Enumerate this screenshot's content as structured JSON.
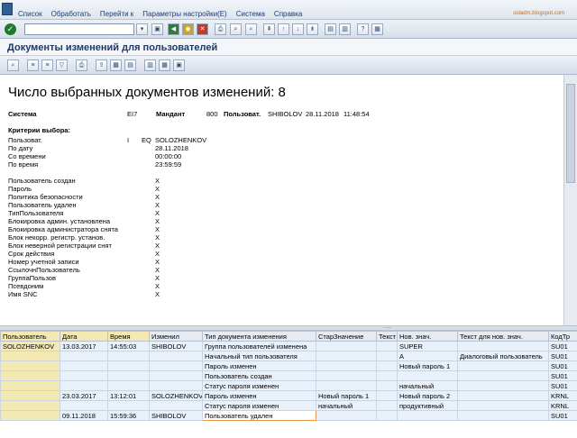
{
  "menu": [
    "Список",
    "Обработать",
    "Перейти к",
    "Параметры настройки(E)",
    "Система",
    "Справка"
  ],
  "site": "sidadm.blogspot.com",
  "title": "Документы изменений для пользователей",
  "report": {
    "heading": "Число выбранных документов изменений: 8",
    "system_label": "Система",
    "system_value": "EI7",
    "client_label": "Мандант",
    "client_value": "800",
    "user_label": "Пользоват.",
    "user_value": "SHIBOLOV",
    "date_value": "28.11.2018",
    "time_value": "11:48:54",
    "criteria_title": "Критерии выбора:",
    "criteria": [
      {
        "label": "Пользоват.",
        "sign": "I",
        "option": "EQ",
        "value": "SOLOZHENKOV"
      },
      {
        "label": "По дату",
        "sign": "",
        "option": "",
        "value": "28.11.2018"
      },
      {
        "label": "Со времени",
        "sign": "",
        "option": "",
        "value": "00:00:00"
      },
      {
        "label": "По время",
        "sign": "",
        "option": "",
        "value": "23:59:59"
      }
    ],
    "flags": [
      {
        "label": "Пользователь создан",
        "value": "X"
      },
      {
        "label": "Пароль",
        "value": "X"
      },
      {
        "label": "Политика безопасности",
        "value": "X"
      },
      {
        "label": "Пользователь удален",
        "value": "X"
      },
      {
        "label": "ТипПользователя",
        "value": "X"
      },
      {
        "label": "Блокировка админ. установлена",
        "value": "X"
      },
      {
        "label": "Блокировка администратора снята",
        "value": "X"
      },
      {
        "label": "Блок некорр. регистр. установ.",
        "value": "X"
      },
      {
        "label": "Блок неверной регистрации снят",
        "value": "X"
      },
      {
        "label": "Срок действия",
        "value": "X"
      },
      {
        "label": "Номер учетной записи",
        "value": "X"
      },
      {
        "label": "СсылочнПользователь",
        "value": "X"
      },
      {
        "label": "ГруппаПользов",
        "value": "X"
      },
      {
        "label": "Псевдоним",
        "value": "X"
      },
      {
        "label": "Имя SNC",
        "value": "X"
      }
    ]
  },
  "table": {
    "columns": [
      "Пользователь",
      "Дата",
      "Время",
      "Изменил",
      "Тип документа изменения",
      "СтарЗначение",
      "Текст",
      "Нов. знач.",
      "Текст для нов. знач.",
      "КодТр"
    ],
    "rows": [
      [
        "SOLOZHENKOV",
        "13.03.2017",
        "14:55:03",
        "SHIBOLOV",
        "Группа пользователей изменена",
        "",
        "",
        "SUPER",
        "",
        "SU01"
      ],
      [
        "",
        "",
        "",
        "",
        "Начальный тип пользователя",
        "",
        "",
        "A",
        "Диалоговый пользователь",
        "SU01"
      ],
      [
        "",
        "",
        "",
        "",
        "Пароль изменен",
        "",
        "",
        "Новый пароль  1",
        "",
        "SU01"
      ],
      [
        "",
        "",
        "",
        "",
        "Пользователь создан",
        "",
        "",
        "",
        "",
        "SU01"
      ],
      [
        "",
        "",
        "",
        "",
        "Статус пароля изменен",
        "",
        "",
        "начальный",
        "",
        "SU01"
      ],
      [
        "",
        "23.03.2017",
        "13:12:01",
        "SOLOZHENKOV",
        "Пароль изменен",
        "Новый пароль  1",
        "",
        "Новый пароль  2",
        "",
        "KRNL"
      ],
      [
        "",
        "",
        "",
        "",
        "Статус пароля изменен",
        "начальный",
        "",
        "продуктивный",
        "",
        "KRNL"
      ],
      [
        "",
        "09.11.2018",
        "15:59:36",
        "SHIBOLOV",
        "Пользователь удален",
        "",
        "",
        "",
        "",
        "SU01"
      ]
    ]
  }
}
